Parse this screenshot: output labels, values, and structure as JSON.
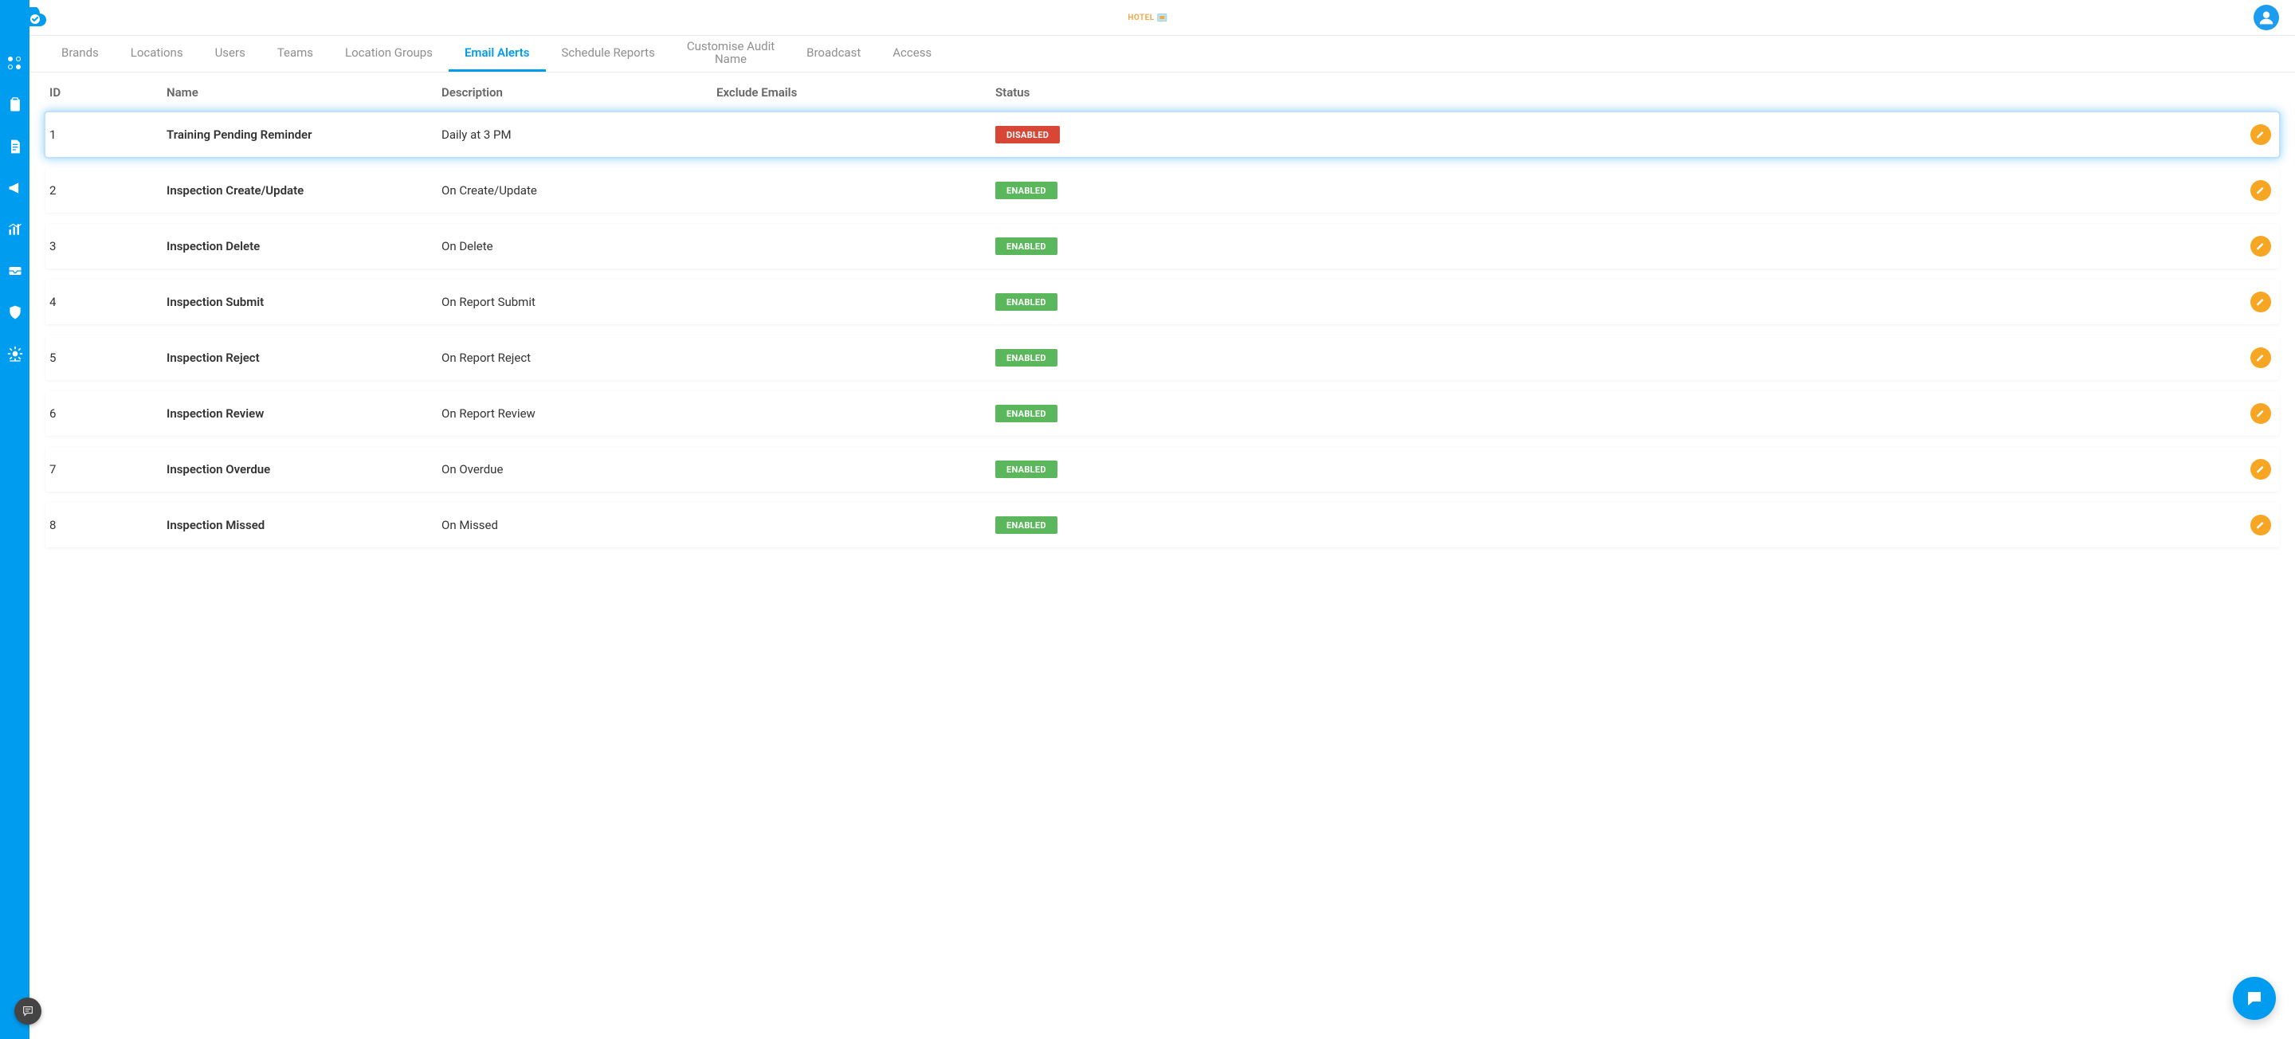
{
  "app": {
    "brand_text": "HOTEL"
  },
  "tabs": [
    {
      "label": "Brands",
      "active": false
    },
    {
      "label": "Locations",
      "active": false
    },
    {
      "label": "Users",
      "active": false
    },
    {
      "label": "Teams",
      "active": false
    },
    {
      "label": "Location Groups",
      "active": false
    },
    {
      "label": "Email Alerts",
      "active": true
    },
    {
      "label": "Schedule Reports",
      "active": false
    },
    {
      "label_line1": "Customise Audit",
      "label_line2": "Name",
      "active": false,
      "multiline": true
    },
    {
      "label": "Broadcast",
      "active": false
    },
    {
      "label": "Access",
      "active": false
    }
  ],
  "columns": {
    "id": "ID",
    "name": "Name",
    "description": "Description",
    "exclude_emails": "Exclude Emails",
    "status": "Status"
  },
  "status_labels": {
    "enabled": "ENABLED",
    "disabled": "DISABLED"
  },
  "rows": [
    {
      "id": "1",
      "name": "Training Pending Reminder",
      "description": "Daily at 3 PM",
      "exclude_emails": "",
      "status": "disabled",
      "selected": true
    },
    {
      "id": "2",
      "name": "Inspection Create/Update",
      "description": "On Create/Update",
      "exclude_emails": "",
      "status": "enabled",
      "selected": false
    },
    {
      "id": "3",
      "name": "Inspection Delete",
      "description": "On Delete",
      "exclude_emails": "",
      "status": "enabled",
      "selected": false
    },
    {
      "id": "4",
      "name": "Inspection Submit",
      "description": "On Report Submit",
      "exclude_emails": "",
      "status": "enabled",
      "selected": false
    },
    {
      "id": "5",
      "name": "Inspection Reject",
      "description": "On Report Reject",
      "exclude_emails": "",
      "status": "enabled",
      "selected": false
    },
    {
      "id": "6",
      "name": "Inspection Review",
      "description": "On Report Review",
      "exclude_emails": "",
      "status": "enabled",
      "selected": false
    },
    {
      "id": "7",
      "name": "Inspection Overdue",
      "description": "On Overdue",
      "exclude_emails": "",
      "status": "enabled",
      "selected": false
    },
    {
      "id": "8",
      "name": "Inspection Missed",
      "description": "On Missed",
      "exclude_emails": "",
      "status": "enabled",
      "selected": false
    }
  ],
  "sidebar_icons": [
    "dashboard",
    "clipboard",
    "document",
    "megaphone",
    "analytics",
    "inbox",
    "shield",
    "settings"
  ]
}
